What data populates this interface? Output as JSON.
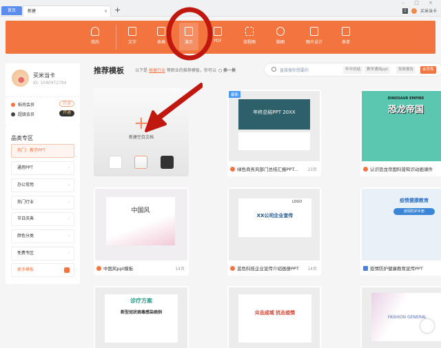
{
  "tabs": {
    "home": "首页",
    "current": "新建",
    "close": "×",
    "add": "+"
  },
  "window": {
    "controls": "– □ ×",
    "user": "买米当卡",
    "notif_count": "1"
  },
  "nav": [
    {
      "label": "我的"
    },
    {
      "label": "文字"
    },
    {
      "label": "表格"
    },
    {
      "label": "演示",
      "active": true
    },
    {
      "label": "PDF"
    },
    {
      "label": "流程图"
    },
    {
      "label": "脑图"
    },
    {
      "label": "图片设计"
    },
    {
      "label": "表单"
    }
  ],
  "profile": {
    "name": "买米当卡",
    "id": "ID: 1040972794",
    "members": [
      {
        "label": "稻壳会员",
        "action": "开通",
        "color": "#f2743f"
      },
      {
        "label": "超级会员",
        "action": "开通",
        "color": "#444444"
      }
    ]
  },
  "category": {
    "title": "品类专区",
    "items": [
      {
        "label": "热门：教学PPT"
      },
      {
        "label": "通用PPT"
      },
      {
        "label": "办公常用"
      },
      {
        "label": "热门行业"
      },
      {
        "label": "节日庆典"
      },
      {
        "label": "颜色分类"
      },
      {
        "label": "免费专区"
      },
      {
        "label": "更多模板"
      }
    ]
  },
  "main": {
    "title": "推荐模板",
    "subtitle_pre": "以下是",
    "industry": "根据行业",
    "subtitle_post": "等职业的推荐模板，你可以",
    "swap": "○ 换一换",
    "search": {
      "placeholder": "直接搜你想要的",
      "chips": [
        "年中总结",
        "教学通用ppt",
        "党政报告",
        "会员免"
      ]
    },
    "new_doc": "新建空白文档",
    "templates": [
      {
        "name": "绿色商务风部门总结汇报PPT...",
        "pages": "23页",
        "badge": "最新",
        "thumb": "年终总结PPT",
        "sub": "20XX"
      },
      {
        "name": "认识恐龙帝国科普知识动画课件",
        "pages": "",
        "thumb": "恐龙帝国",
        "sub": "DINOSAUR EMPIRE"
      },
      {
        "name": "中国风ppt模板",
        "pages": "14页",
        "thumb": "中国风"
      },
      {
        "name": "蓝色科技企业宣传介绍画册PPT",
        "pages": "14页",
        "thumb": "XX公司企业宣传",
        "sub": "LOGO"
      },
      {
        "name": "疫情防护健康教育宣传PPT",
        "pages": "",
        "thumb": "疫情健康教育",
        "sub": "疫情防护手册"
      },
      {
        "name": "",
        "thumb": "诊疗方案",
        "sub": "新型冠状病毒感染病例"
      },
      {
        "name": "",
        "thumb": "众志成城 抗击疫情"
      },
      {
        "name": "",
        "thumb": "FASHION GENERAL"
      }
    ]
  },
  "colors": {
    "accent": "#f2743f",
    "annotation": "#c0180e"
  }
}
